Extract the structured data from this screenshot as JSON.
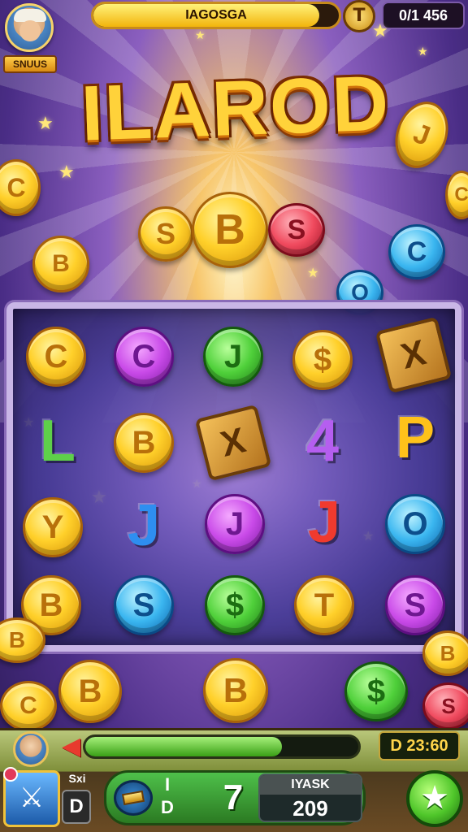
{
  "hud": {
    "avatar_label": "SNUUS",
    "progress_label": "IAGOSGA",
    "progress_fraction": 0.92,
    "badge_icon": "T",
    "score_top": "0/1 456"
  },
  "title": "ILAROD",
  "top_coins": [
    "S",
    "B",
    "S",
    "C",
    "O"
  ],
  "board": {
    "rows": [
      [
        "C",
        "C",
        "J",
        "$",
        "X"
      ],
      [
        "L",
        "B",
        "X",
        "4",
        "P"
      ],
      [
        "Y",
        "J",
        "J",
        "J",
        "O"
      ],
      [
        "B",
        "S",
        "$",
        "T",
        "S"
      ]
    ]
  },
  "bottom": {
    "progress_fraction": 0.72,
    "timer": "D 23:60",
    "side_label": "Sxi",
    "side_value": "D",
    "action_top": "I",
    "action_bottom": "D",
    "action_number": "7",
    "score_label": "IYASK",
    "score_value": "209",
    "item_label": "S"
  },
  "colors": {
    "gold": "#ffd02a",
    "purple": "#c94ae8",
    "green": "#4fd03a",
    "blue": "#3ab6f0",
    "red": "#f04a5e"
  }
}
